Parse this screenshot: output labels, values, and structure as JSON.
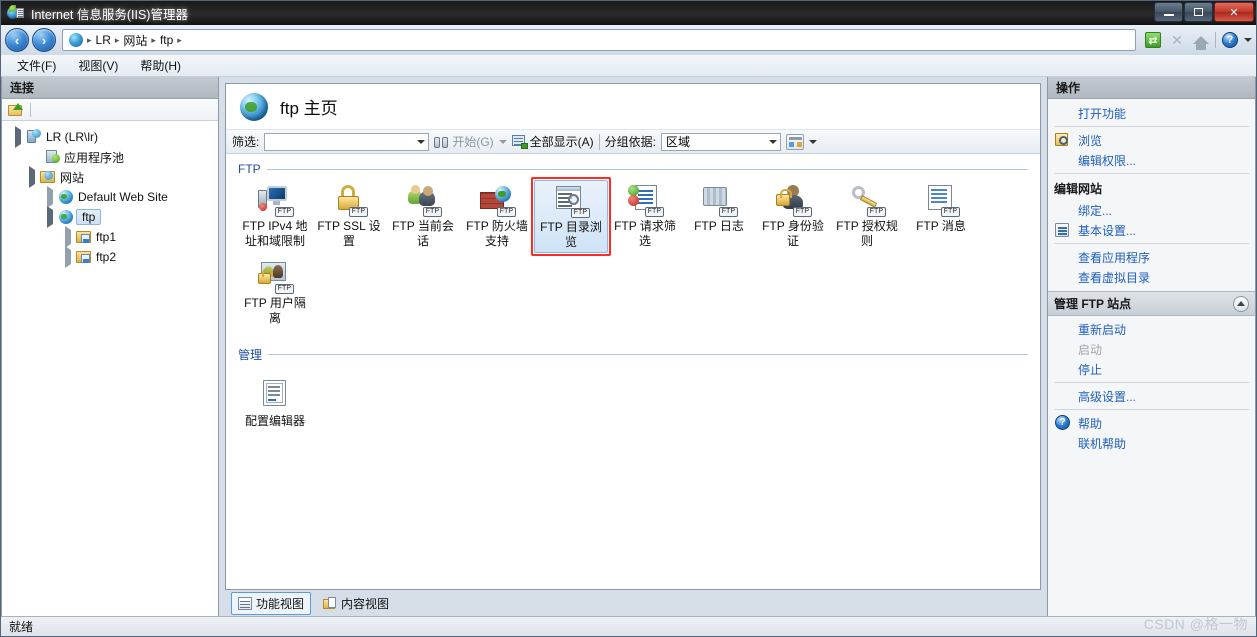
{
  "window": {
    "title": "Internet 信息服务(IIS)管理器",
    "title_icon": "iis-globe-icon",
    "buttons": {
      "minimize": "–",
      "maximize": "❐",
      "close": "✕"
    }
  },
  "navbar": {
    "back": "‹",
    "forward": "›",
    "breadcrumb": [
      {
        "label": "LR"
      },
      {
        "label": "网站"
      },
      {
        "label": "ftp"
      }
    ],
    "separator": "▸",
    "tools": {
      "refresh": "↻",
      "stop": "✕",
      "home": "home-icon",
      "help": "?",
      "help_caret": "▾"
    }
  },
  "menubar": {
    "items": [
      {
        "label": "文件(F)"
      },
      {
        "label": "视图(V)"
      },
      {
        "label": "帮助(H)"
      }
    ]
  },
  "connections": {
    "header": "连接",
    "tree": [
      {
        "label": "LR (LR\\lr)",
        "icon": "server-icon",
        "indent": 0,
        "expander": "open"
      },
      {
        "label": "应用程序池",
        "icon": "app-pool-icon",
        "indent": 1,
        "expander": "none"
      },
      {
        "label": "网站",
        "icon": "sites-folder-icon",
        "indent": 1,
        "expander": "open"
      },
      {
        "label": "Default Web Site",
        "icon": "website-globe-icon",
        "indent": 2,
        "expander": "closed"
      },
      {
        "label": "ftp",
        "icon": "website-globe-icon",
        "indent": 2,
        "expander": "open",
        "selected": true
      },
      {
        "label": "ftp1",
        "icon": "virtual-dir-icon",
        "indent": 3,
        "expander": "closed"
      },
      {
        "label": "ftp2",
        "icon": "virtual-dir-icon",
        "indent": 3,
        "expander": "closed"
      }
    ]
  },
  "main": {
    "page_title": "ftp 主页",
    "filter_bar": {
      "filter_label": "筛选:",
      "filter_value": "",
      "filter_placeholder": "",
      "start_button": "开始(G)",
      "show_all_button": "全部显示(A)",
      "group_by_label": "分组依据:",
      "group_by_value": "区域"
    },
    "sections": [
      {
        "title": "FTP",
        "items": [
          {
            "label": "FTP IPv4 地址和域限制",
            "icon": "ftp-ipv4-restrictions-icon"
          },
          {
            "label": "FTP SSL 设置",
            "icon": "ftp-ssl-settings-icon"
          },
          {
            "label": "FTP 当前会话",
            "icon": "ftp-current-sessions-icon"
          },
          {
            "label": "FTP 防火墙支持",
            "icon": "ftp-firewall-support-icon"
          },
          {
            "label": "FTP 目录浏览",
            "icon": "ftp-directory-browsing-icon",
            "selected": true,
            "annotated": true
          },
          {
            "label": "FTP 请求筛选",
            "icon": "ftp-request-filtering-icon"
          },
          {
            "label": "FTP 日志",
            "icon": "ftp-logging-icon"
          },
          {
            "label": "FTP 身份验证",
            "icon": "ftp-authentication-icon"
          },
          {
            "label": "FTP 授权规则",
            "icon": "ftp-authorization-rules-icon"
          },
          {
            "label": "FTP 消息",
            "icon": "ftp-messages-icon"
          },
          {
            "label": "FTP 用户隔离",
            "icon": "ftp-user-isolation-icon"
          }
        ]
      },
      {
        "title": "管理",
        "items": [
          {
            "label": "配置编辑器",
            "icon": "configuration-editor-icon"
          }
        ]
      }
    ],
    "view_tabs": [
      {
        "label": "功能视图",
        "icon": "features-view-icon",
        "active": true
      },
      {
        "label": "内容视图",
        "icon": "content-view-icon",
        "active": false
      }
    ]
  },
  "actions": {
    "header": "操作",
    "rows": [
      {
        "label": "打开功能",
        "type": "link",
        "icon": ""
      },
      {
        "type": "divider"
      },
      {
        "label": "浏览",
        "type": "link",
        "icon": "browse-icon"
      },
      {
        "label": "编辑权限...",
        "type": "link",
        "icon": ""
      },
      {
        "type": "divider"
      },
      {
        "label": "编辑网站",
        "type": "subhead"
      },
      {
        "label": "绑定...",
        "type": "link",
        "icon": ""
      },
      {
        "label": "基本设置...",
        "type": "link",
        "icon": "basic-settings-icon"
      },
      {
        "type": "divider"
      },
      {
        "label": "查看应用程序",
        "type": "link",
        "icon": ""
      },
      {
        "label": "查看虚拟目录",
        "type": "link",
        "icon": ""
      },
      {
        "label": "管理 FTP 站点",
        "type": "group",
        "chevron": "collapse-chevron-icon"
      },
      {
        "label": "重新启动",
        "type": "link",
        "icon": ""
      },
      {
        "label": "启动",
        "type": "link",
        "icon": "",
        "disabled": true
      },
      {
        "label": "停止",
        "type": "link",
        "icon": ""
      },
      {
        "type": "divider"
      },
      {
        "label": "高级设置...",
        "type": "link",
        "icon": ""
      },
      {
        "type": "divider"
      },
      {
        "label": "帮助",
        "type": "link",
        "icon": "help-icon"
      },
      {
        "label": "联机帮助",
        "type": "link",
        "icon": ""
      }
    ]
  },
  "statusbar": {
    "text": "就绪",
    "watermark": "CSDN @格一物"
  },
  "colors": {
    "accent_link": "#1f5fbe",
    "section_title": "#1f4e9c",
    "annotation": "#ff2b22",
    "selection_border": "#8fb8e0"
  }
}
